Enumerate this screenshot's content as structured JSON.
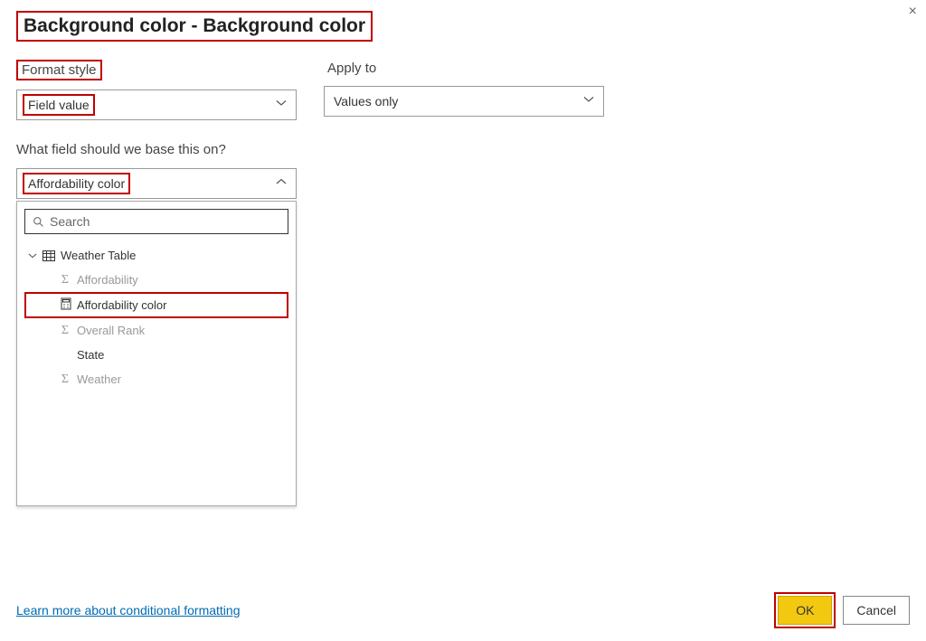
{
  "title": "Background color - Background color",
  "close": "×",
  "formatStyle": {
    "label": "Format style",
    "value": "Field value"
  },
  "applyTo": {
    "label": "Apply to",
    "value": "Values only"
  },
  "question": "What field should we base this on?",
  "fieldSelect": {
    "value": "Affordability color"
  },
  "search": {
    "placeholder": "Search"
  },
  "tree": {
    "table": "Weather Table",
    "fields": {
      "f0": "Affordability",
      "f1": "Affordability color",
      "f2": "Overall Rank",
      "f3": "State",
      "f4": "Weather"
    }
  },
  "footer": {
    "learn": "Learn more about conditional formatting",
    "ok": "OK",
    "cancel": "Cancel"
  }
}
